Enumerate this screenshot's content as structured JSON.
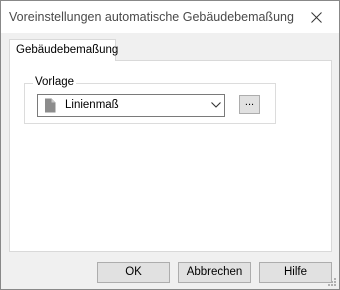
{
  "dialog": {
    "title": "Voreinstellungen automatische Gebäudebemaßung",
    "close_icon": "close-icon"
  },
  "tabs": [
    {
      "label": "Gebäudebemaßung",
      "selected": true
    }
  ],
  "group": {
    "label": "Vorlage",
    "combo_value": "Linienmaß",
    "combo_icon": "document-icon",
    "dropdown_icon": "chevron-down-icon",
    "browse_label": "..."
  },
  "buttons": {
    "ok": "OK",
    "cancel": "Abbrechen",
    "help": "Hilfe"
  },
  "colors": {
    "dialog_bg": "#f0f0f0",
    "titlebar_bg": "#ffffff",
    "button_bg": "#e1e1e1",
    "button_border": "#adadad"
  }
}
